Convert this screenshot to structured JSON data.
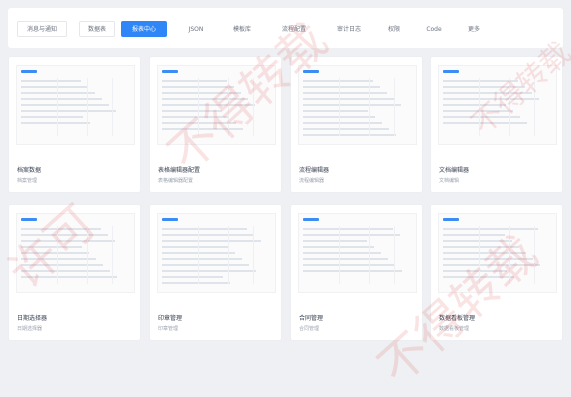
{
  "tabs": [
    {
      "label": "消息与通知",
      "active": false
    },
    {
      "label": "数据表",
      "active": false
    },
    {
      "label": "报表中心",
      "active": true
    },
    {
      "label": "JSON",
      "active": false
    },
    {
      "label": "模板库",
      "active": false
    },
    {
      "label": "流程配置",
      "active": false
    },
    {
      "label": "审计日志",
      "active": false
    },
    {
      "label": "权限",
      "active": false
    },
    {
      "label": "Code",
      "active": false
    },
    {
      "label": "更多",
      "active": false
    }
  ],
  "cards": [
    {
      "title": "档案数据",
      "subtitle": "档案管理"
    },
    {
      "title": "表格编辑器配置",
      "subtitle": "表格编辑器配置"
    },
    {
      "title": "流程编辑器",
      "subtitle": "流程编辑器"
    },
    {
      "title": "文档编辑器",
      "subtitle": "文档编辑"
    },
    {
      "title": "日期选择器",
      "subtitle": "日期选择器"
    },
    {
      "title": "印章管理",
      "subtitle": "印章管理"
    },
    {
      "title": "合同管理",
      "subtitle": "合同管理"
    },
    {
      "title": "数据看板管理",
      "subtitle": "数据看板管理"
    }
  ],
  "watermarks": [
    "不得转载",
    "不得转载",
    "许可",
    "不得转载"
  ],
  "colors": {
    "accent": "#2f86f6",
    "background": "#eef0f3",
    "watermark": "#dc3c3c"
  }
}
